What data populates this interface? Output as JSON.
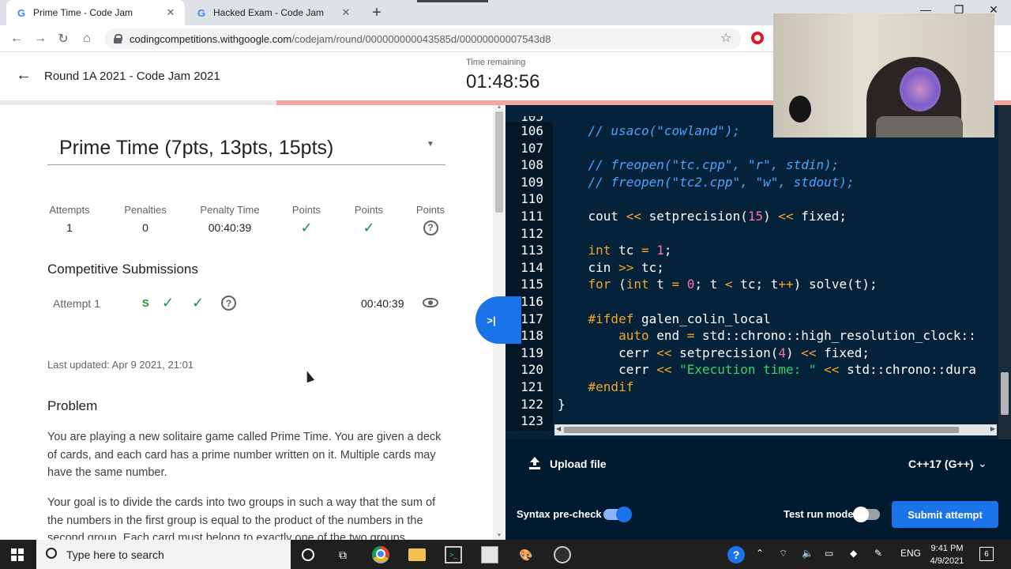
{
  "browser": {
    "tabs": [
      {
        "title": "Prime Time - Code Jam",
        "active": true
      },
      {
        "title": "Hacked Exam - Code Jam",
        "active": false
      }
    ],
    "url_host": "codingcompetitions.withgoogle.com",
    "url_path": "/codejam/round/000000000043585d/00000000007543d8",
    "icons": {
      "favicon": "google-g-icon",
      "close": "close-icon",
      "new_tab": "plus-icon",
      "back": "back-arrow-icon",
      "forward": "forward-arrow-icon",
      "reload": "reload-icon",
      "home": "home-icon",
      "bookmark": "star-icon",
      "extension": "opera-icon"
    }
  },
  "header": {
    "round_title": "Round 1A 2021 - Code Jam 2021",
    "time_label": "Time remaining",
    "time_remaining": "01:48:56",
    "elapsed_fraction": 0.27
  },
  "problem": {
    "title": "Prime Time (7pts, 13pts, 15pts)",
    "stats": [
      {
        "label": "Attempts",
        "value": "1"
      },
      {
        "label": "Penalties",
        "value": "0"
      },
      {
        "label": "Penalty Time",
        "value": "00:40:39"
      },
      {
        "label": "Points",
        "status": "check-icon"
      },
      {
        "label": "Points",
        "status": "check-icon"
      },
      {
        "label": "Points",
        "status": "question-icon"
      }
    ],
    "submissions_heading": "Competitive Submissions",
    "attempt": {
      "label": "Attempt 1",
      "sample_badge": "S",
      "time": "00:40:39"
    },
    "last_updated": "Last updated: Apr 9 2021, 21:01",
    "problem_heading": "Problem",
    "paragraph1": "You are playing a new solitaire game called Prime Time. You are given a deck of cards, and each card has a prime number written on it. Multiple cards may have the same number.",
    "paragraph2": "Your goal is to divide the cards into two groups in such a way that the sum of the numbers in the first group is equal to the product of the numbers in the second group. Each card must belong to exactly one of the two groups"
  },
  "collapse_button": ">|",
  "editor": {
    "top_partial_line": "105",
    "lines": [
      {
        "n": "106",
        "tokens": [
          {
            "t": "    ",
            "c": ""
          },
          {
            "t": "// usaco(\"cowland\");",
            "c": "cm"
          }
        ]
      },
      {
        "n": "107",
        "tokens": []
      },
      {
        "n": "108",
        "tokens": [
          {
            "t": "    ",
            "c": ""
          },
          {
            "t": "// freopen(\"tc.cpp\", \"r\", stdin);",
            "c": "cm"
          }
        ]
      },
      {
        "n": "109",
        "tokens": [
          {
            "t": "    ",
            "c": ""
          },
          {
            "t": "// freopen(\"tc2.cpp\", \"w\", stdout);",
            "c": "cm"
          }
        ]
      },
      {
        "n": "110",
        "tokens": []
      },
      {
        "n": "111",
        "tokens": [
          {
            "t": "    cout ",
            "c": ""
          },
          {
            "t": "<<",
            "c": "kw"
          },
          {
            "t": " setprecision(",
            "c": ""
          },
          {
            "t": "15",
            "c": "num"
          },
          {
            "t": ") ",
            "c": ""
          },
          {
            "t": "<<",
            "c": "kw"
          },
          {
            "t": " fixed;",
            "c": ""
          }
        ]
      },
      {
        "n": "112",
        "tokens": []
      },
      {
        "n": "113",
        "tokens": [
          {
            "t": "    ",
            "c": ""
          },
          {
            "t": "int",
            "c": "kw"
          },
          {
            "t": " tc ",
            "c": ""
          },
          {
            "t": "=",
            "c": "kw"
          },
          {
            "t": " ",
            "c": ""
          },
          {
            "t": "1",
            "c": "num"
          },
          {
            "t": ";",
            "c": ""
          }
        ]
      },
      {
        "n": "114",
        "tokens": [
          {
            "t": "    cin ",
            "c": ""
          },
          {
            "t": ">>",
            "c": "kw"
          },
          {
            "t": " tc;",
            "c": ""
          }
        ]
      },
      {
        "n": "115",
        "tokens": [
          {
            "t": "    ",
            "c": ""
          },
          {
            "t": "for",
            "c": "kw"
          },
          {
            "t": " (",
            "c": ""
          },
          {
            "t": "int",
            "c": "kw"
          },
          {
            "t": " t ",
            "c": ""
          },
          {
            "t": "=",
            "c": "kw"
          },
          {
            "t": " ",
            "c": ""
          },
          {
            "t": "0",
            "c": "num"
          },
          {
            "t": "; t ",
            "c": ""
          },
          {
            "t": "<",
            "c": "kw"
          },
          {
            "t": " tc; t",
            "c": ""
          },
          {
            "t": "++",
            "c": "kw"
          },
          {
            "t": ") solve(t);",
            "c": ""
          }
        ]
      },
      {
        "n": "116",
        "tokens": []
      },
      {
        "n": "117",
        "tokens": [
          {
            "t": "    ",
            "c": ""
          },
          {
            "t": "#ifdef",
            "c": "kw"
          },
          {
            "t": " galen_colin_local",
            "c": ""
          }
        ]
      },
      {
        "n": "118",
        "tokens": [
          {
            "t": "        ",
            "c": ""
          },
          {
            "t": "auto",
            "c": "kw"
          },
          {
            "t": " end ",
            "c": ""
          },
          {
            "t": "=",
            "c": "kw"
          },
          {
            "t": " std::chrono::high_resolution_clock::",
            "c": ""
          }
        ]
      },
      {
        "n": "119",
        "tokens": [
          {
            "t": "        cerr ",
            "c": ""
          },
          {
            "t": "<<",
            "c": "kw"
          },
          {
            "t": " setprecision(",
            "c": ""
          },
          {
            "t": "4",
            "c": "num"
          },
          {
            "t": ") ",
            "c": ""
          },
          {
            "t": "<<",
            "c": "kw"
          },
          {
            "t": " fixed;",
            "c": ""
          }
        ]
      },
      {
        "n": "120",
        "tokens": [
          {
            "t": "        cerr ",
            "c": ""
          },
          {
            "t": "<<",
            "c": "kw"
          },
          {
            "t": " ",
            "c": ""
          },
          {
            "t": "\"Execution time: \"",
            "c": "str"
          },
          {
            "t": " ",
            "c": ""
          },
          {
            "t": "<<",
            "c": "kw"
          },
          {
            "t": " std::chrono::dura",
            "c": ""
          }
        ]
      },
      {
        "n": "121",
        "tokens": [
          {
            "t": "    ",
            "c": ""
          },
          {
            "t": "#endif",
            "c": "kw"
          }
        ]
      },
      {
        "n": "122",
        "tokens": [
          {
            "t": "}",
            "c": ""
          }
        ]
      },
      {
        "n": "123",
        "tokens": []
      }
    ],
    "colors": {
      "background": "#04223a",
      "comment": "#4aa6ff",
      "keyword": "#f5a623",
      "number": "#ff6fa8",
      "string": "#36d36b"
    }
  },
  "editor_footer": {
    "upload_label": "Upload file",
    "language": "C++17 (G++)",
    "syntax_label": "Syntax pre-check",
    "syntax_on": true,
    "test_run_label": "Test run mode",
    "test_run_on": false,
    "submit_label": "Submit attempt"
  },
  "taskbar": {
    "search_placeholder": "Type here to search",
    "language": "ENG",
    "time": "9:41 PM",
    "date": "4/9/2021",
    "notification_count": "6",
    "icons": [
      "windows-logo-icon",
      "cortana-icon",
      "task-view-icon",
      "chrome-icon",
      "file-explorer-icon",
      "terminal-icon",
      "notepad-icon",
      "paint-icon",
      "obs-icon",
      "help-icon",
      "chevron-up-icon",
      "network-icon",
      "volume-icon",
      "battery-icon",
      "dropbox-icon",
      "pen-icon"
    ]
  }
}
